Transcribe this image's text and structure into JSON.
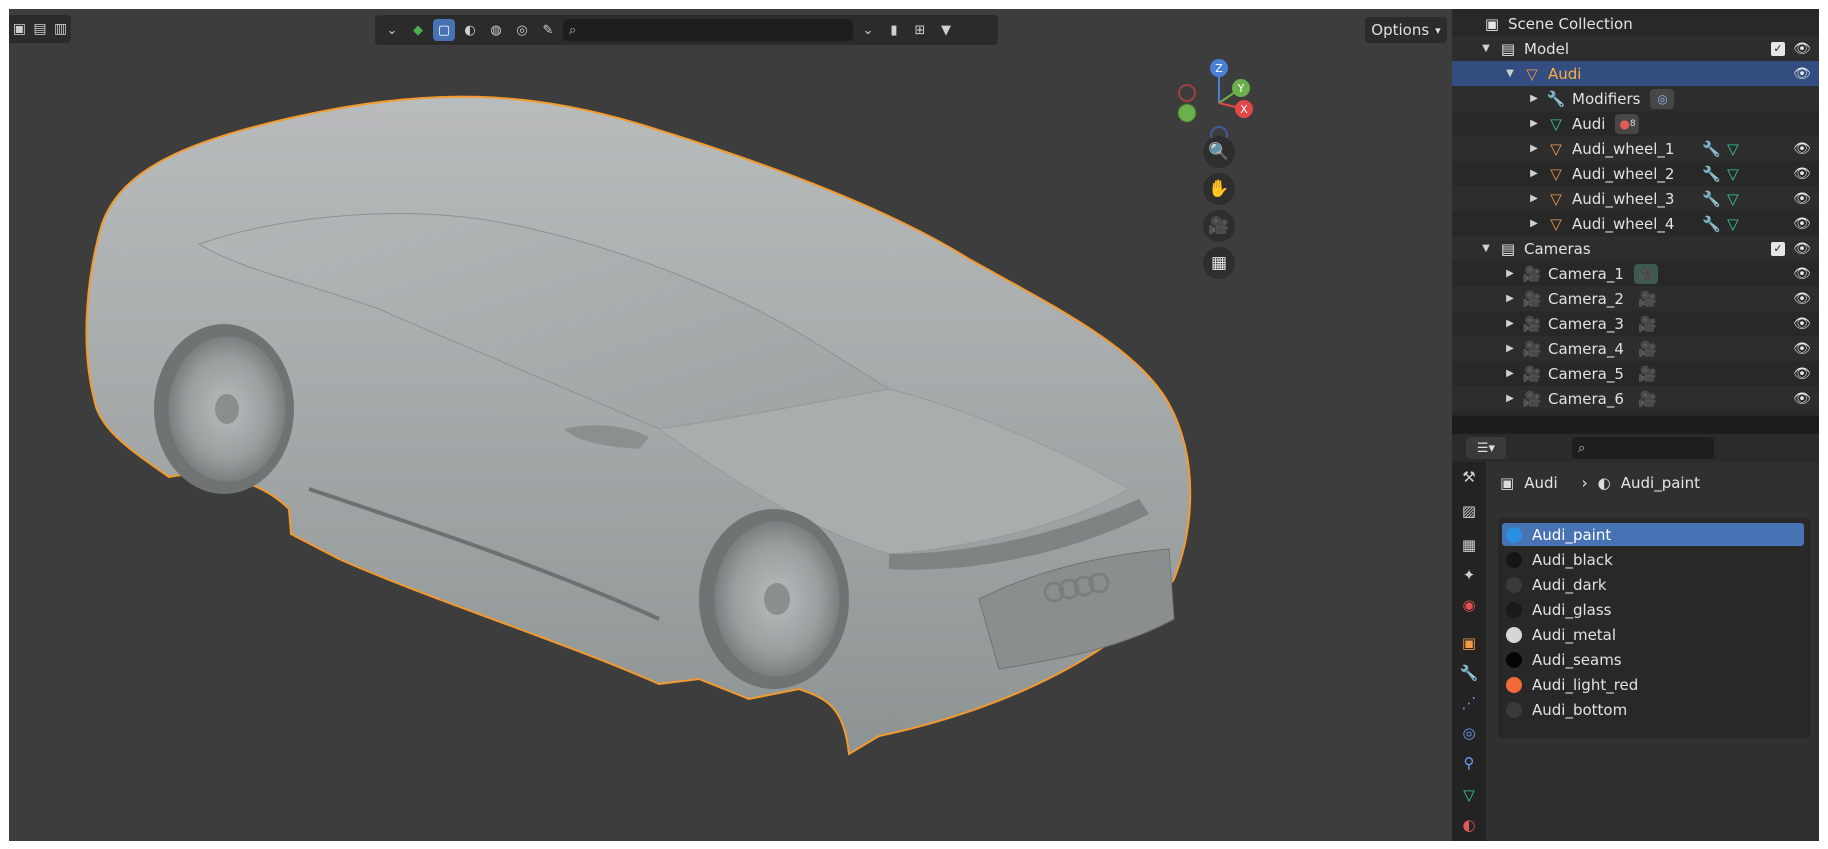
{
  "viewport": {
    "options_label": "Options",
    "gizmo_axes": {
      "z": "Z",
      "y": "Y",
      "x": "X"
    }
  },
  "outliner": {
    "rows": [
      {
        "label": "Scene Collection",
        "icon": "scene-collection-icon"
      },
      {
        "label": "Model",
        "icon": "collection-icon"
      },
      {
        "label": "Audi",
        "icon": "object-icon",
        "selected": true
      },
      {
        "label": "Modifiers",
        "icon": "wrench-icon"
      },
      {
        "label": "Audi",
        "icon": "mesh-data-icon",
        "badge": "8"
      },
      {
        "label": "Audi_wheel_1",
        "icon": "object-icon"
      },
      {
        "label": "Audi_wheel_2",
        "icon": "object-icon"
      },
      {
        "label": "Audi_wheel_3",
        "icon": "object-icon"
      },
      {
        "label": "Audi_wheel_4",
        "icon": "object-icon"
      },
      {
        "label": "Cameras",
        "icon": "collection-icon"
      },
      {
        "label": "Camera_1",
        "icon": "camera-icon"
      },
      {
        "label": "Camera_2",
        "icon": "camera-icon"
      },
      {
        "label": "Camera_3",
        "icon": "camera-icon"
      },
      {
        "label": "Camera_4",
        "icon": "camera-icon"
      },
      {
        "label": "Camera_5",
        "icon": "camera-icon"
      },
      {
        "label": "Camera_6",
        "icon": "camera-icon"
      }
    ]
  },
  "properties": {
    "breadcrumb": {
      "object": "Audi",
      "material": "Audi_paint"
    },
    "materials": [
      {
        "name": "Audi_paint",
        "color": "#2a8fe0",
        "selected": true
      },
      {
        "name": "Audi_black",
        "color": "#151515"
      },
      {
        "name": "Audi_dark",
        "color": "#3a3a3a"
      },
      {
        "name": "Audi_glass",
        "color": "#1a1a1a"
      },
      {
        "name": "Audi_metal",
        "color": "#d6d6d6"
      },
      {
        "name": "Audi_seams",
        "color": "#050505"
      },
      {
        "name": "Audi_light_red",
        "color": "#f26a3a"
      },
      {
        "name": "Audi_bottom",
        "color": "#3a3a3a"
      }
    ]
  },
  "colors": {
    "selection_outline": "#f29a2e",
    "accent": "#4772b3",
    "outliner_selected": "#334d80"
  }
}
